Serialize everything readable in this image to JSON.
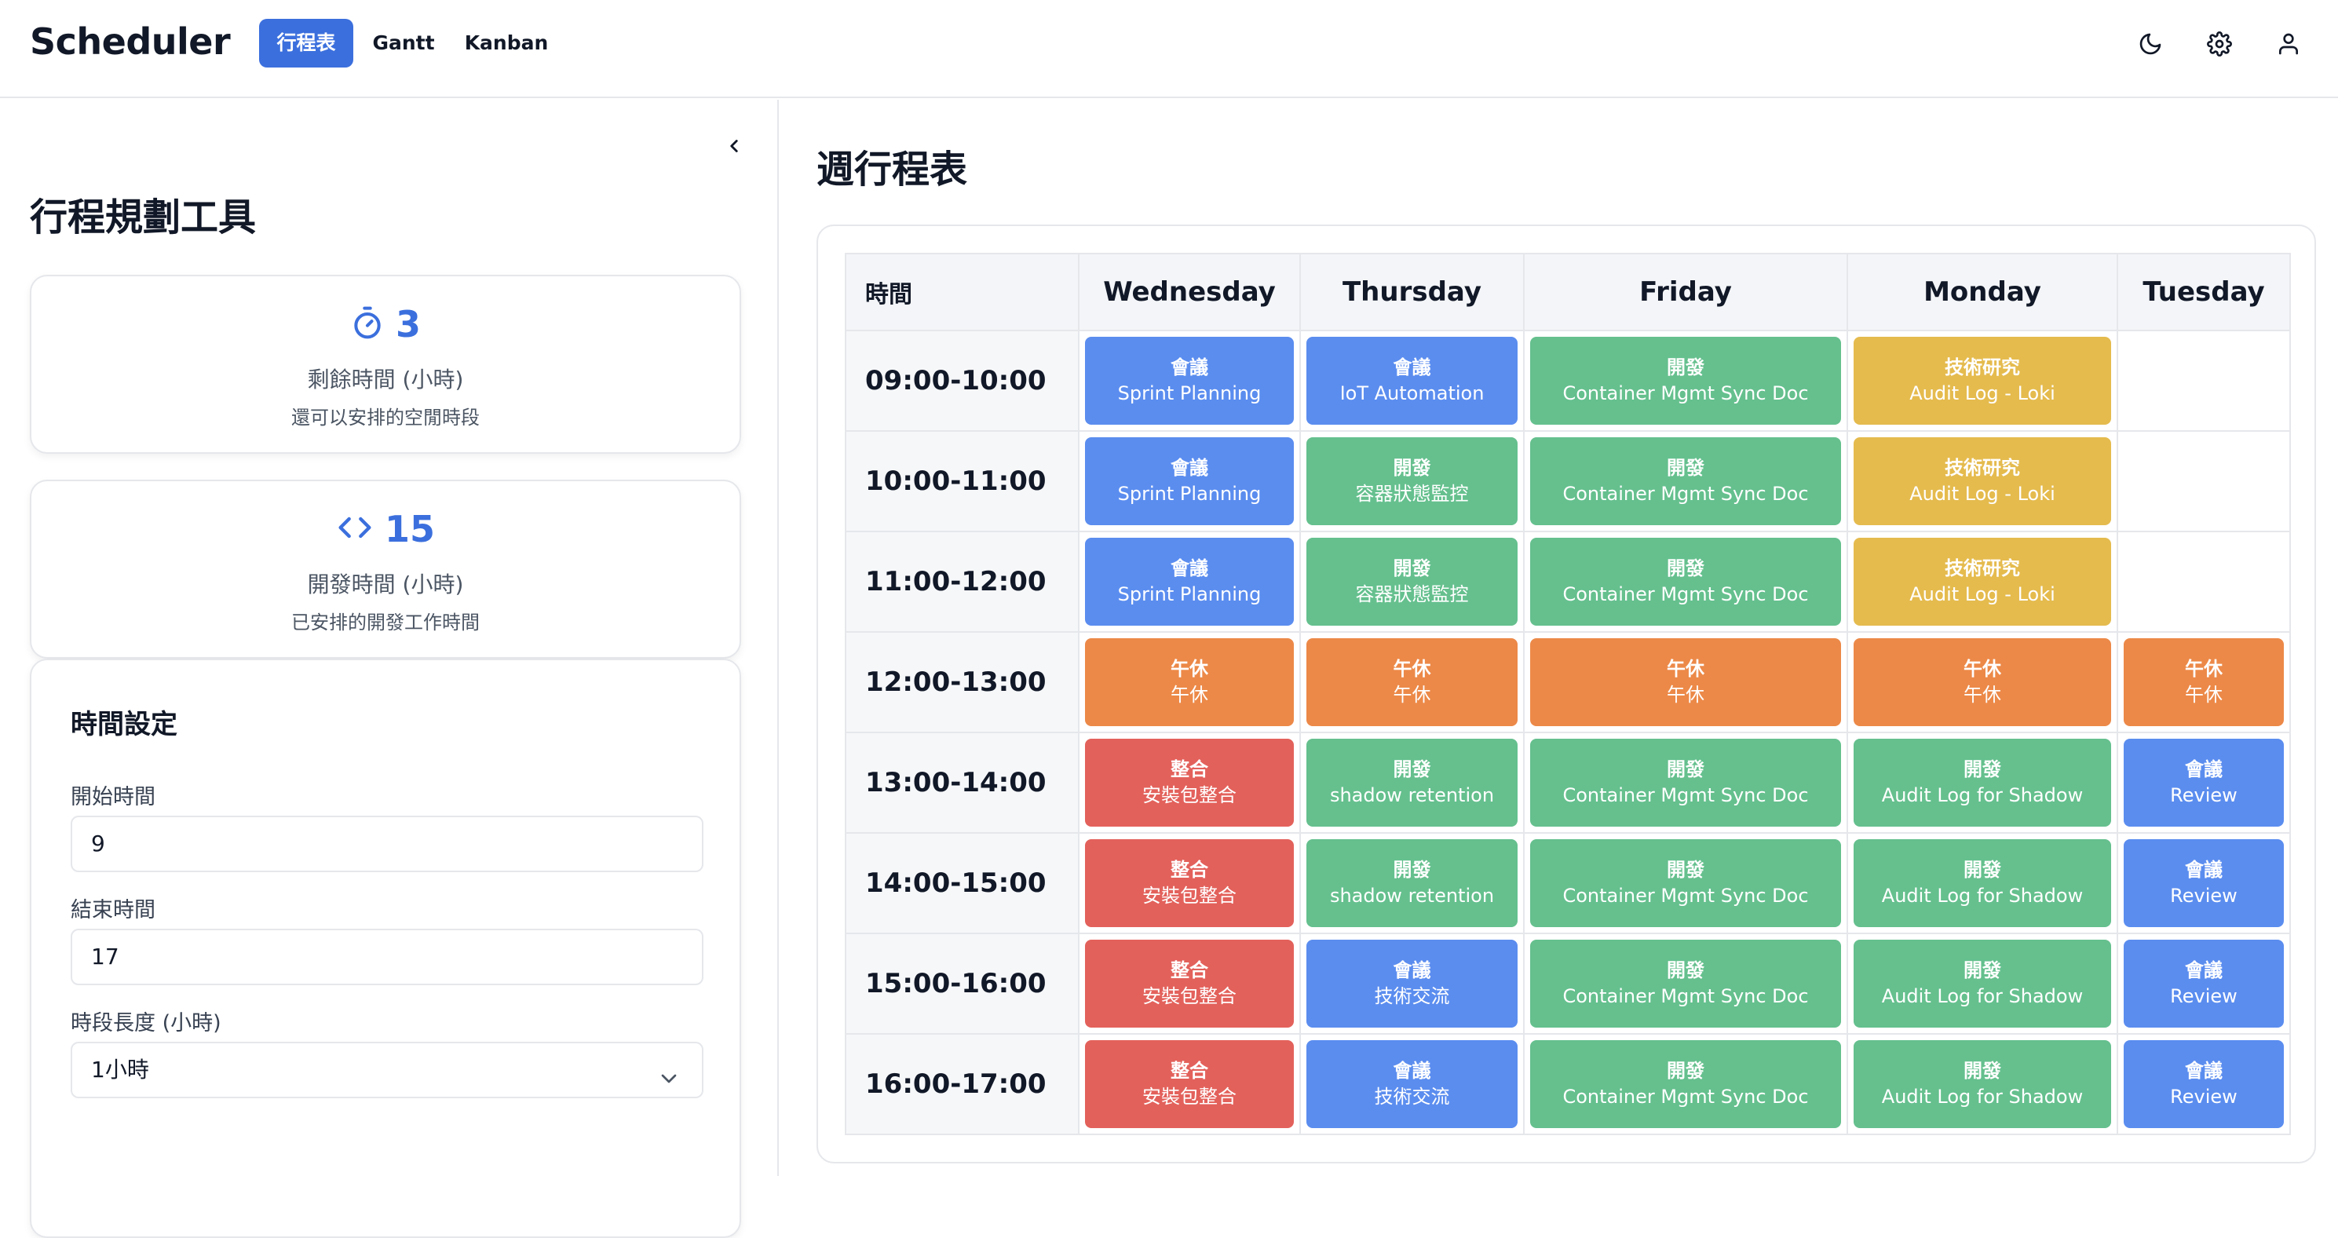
{
  "app": {
    "title": "Scheduler",
    "nav": [
      {
        "label": "行程表",
        "active": true
      },
      {
        "label": "Gantt",
        "active": false
      },
      {
        "label": "Kanban",
        "active": false
      }
    ],
    "icons": [
      "moon-icon",
      "gear-icon",
      "user-icon"
    ]
  },
  "sidebar": {
    "title": "行程規劃工具",
    "remaining": {
      "value": "3",
      "label": "剩餘時間 (小時)",
      "desc": "還可以安排的空閒時段",
      "icon": "stopwatch-icon"
    },
    "dev": {
      "value": "15",
      "label": "開發時間 (小時)",
      "desc": "已安排的開發工作時間",
      "icon": "code-icon"
    },
    "settings": {
      "title": "時間設定",
      "start_label": "開始時間",
      "start_value": "9",
      "end_label": "結束時間",
      "end_value": "17",
      "slot_label": "時段長度 (小時)",
      "slot_value": "1小時"
    }
  },
  "main": {
    "title": "週行程表",
    "time_header": "時間",
    "days": [
      "Wednesday",
      "Thursday",
      "Friday",
      "Monday",
      "Tuesday"
    ],
    "category_colors": {
      "meeting": "#5b8def",
      "dev": "#65c08e",
      "research": "#e5bb4e",
      "lunch": "#ec8948",
      "integration": "#e3615b"
    },
    "rows": [
      {
        "time": "09:00-10:00",
        "cells": [
          {
            "cat": "會議",
            "name": "Sprint Planning",
            "type": "meeting"
          },
          {
            "cat": "會議",
            "name": "IoT Automation",
            "type": "meeting"
          },
          {
            "cat": "開發",
            "name": "Container Mgmt Sync Doc",
            "type": "dev"
          },
          {
            "cat": "技術研究",
            "name": "Audit Log - Loki",
            "type": "research"
          },
          null
        ]
      },
      {
        "time": "10:00-11:00",
        "cells": [
          {
            "cat": "會議",
            "name": "Sprint Planning",
            "type": "meeting"
          },
          {
            "cat": "開發",
            "name": "容器狀態監控",
            "type": "dev"
          },
          {
            "cat": "開發",
            "name": "Container Mgmt Sync Doc",
            "type": "dev"
          },
          {
            "cat": "技術研究",
            "name": "Audit Log - Loki",
            "type": "research"
          },
          null
        ]
      },
      {
        "time": "11:00-12:00",
        "cells": [
          {
            "cat": "會議",
            "name": "Sprint Planning",
            "type": "meeting"
          },
          {
            "cat": "開發",
            "name": "容器狀態監控",
            "type": "dev"
          },
          {
            "cat": "開發",
            "name": "Container Mgmt Sync Doc",
            "type": "dev"
          },
          {
            "cat": "技術研究",
            "name": "Audit Log - Loki",
            "type": "research"
          },
          null
        ]
      },
      {
        "time": "12:00-13:00",
        "cells": [
          {
            "cat": "午休",
            "name": "午休",
            "type": "lunch"
          },
          {
            "cat": "午休",
            "name": "午休",
            "type": "lunch"
          },
          {
            "cat": "午休",
            "name": "午休",
            "type": "lunch"
          },
          {
            "cat": "午休",
            "name": "午休",
            "type": "lunch"
          },
          {
            "cat": "午休",
            "name": "午休",
            "type": "lunch"
          }
        ]
      },
      {
        "time": "13:00-14:00",
        "cells": [
          {
            "cat": "整合",
            "name": "安裝包整合",
            "type": "integration"
          },
          {
            "cat": "開發",
            "name": "shadow retention",
            "type": "dev"
          },
          {
            "cat": "開發",
            "name": "Container Mgmt Sync Doc",
            "type": "dev"
          },
          {
            "cat": "開發",
            "name": "Audit Log for Shadow",
            "type": "dev"
          },
          {
            "cat": "會議",
            "name": "Review",
            "type": "meeting"
          }
        ]
      },
      {
        "time": "14:00-15:00",
        "cells": [
          {
            "cat": "整合",
            "name": "安裝包整合",
            "type": "integration"
          },
          {
            "cat": "開發",
            "name": "shadow retention",
            "type": "dev"
          },
          {
            "cat": "開發",
            "name": "Container Mgmt Sync Doc",
            "type": "dev"
          },
          {
            "cat": "開發",
            "name": "Audit Log for Shadow",
            "type": "dev"
          },
          {
            "cat": "會議",
            "name": "Review",
            "type": "meeting"
          }
        ]
      },
      {
        "time": "15:00-16:00",
        "cells": [
          {
            "cat": "整合",
            "name": "安裝包整合",
            "type": "integration"
          },
          {
            "cat": "會議",
            "name": "技術交流",
            "type": "meeting"
          },
          {
            "cat": "開發",
            "name": "Container Mgmt Sync Doc",
            "type": "dev"
          },
          {
            "cat": "開發",
            "name": "Audit Log for Shadow",
            "type": "dev"
          },
          {
            "cat": "會議",
            "name": "Review",
            "type": "meeting"
          }
        ]
      },
      {
        "time": "16:00-17:00",
        "cells": [
          {
            "cat": "整合",
            "name": "安裝包整合",
            "type": "integration"
          },
          {
            "cat": "會議",
            "name": "技術交流",
            "type": "meeting"
          },
          {
            "cat": "開發",
            "name": "Container Mgmt Sync Doc",
            "type": "dev"
          },
          {
            "cat": "開發",
            "name": "Audit Log for Shadow",
            "type": "dev"
          },
          {
            "cat": "會議",
            "name": "Review",
            "type": "meeting"
          }
        ]
      }
    ]
  }
}
